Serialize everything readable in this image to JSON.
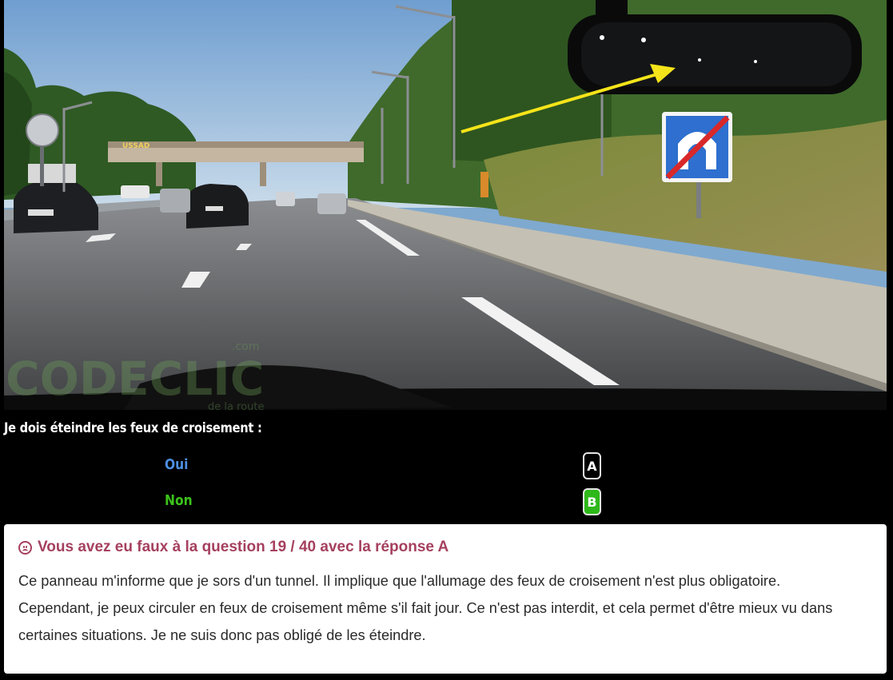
{
  "scene": {
    "description_icon": "road-photo",
    "watermark": "CODECLIC",
    "watermark_suffix": ".com",
    "watermark_tagline": "de la route",
    "bridge_sign": "USSAD"
  },
  "question": {
    "text": "Je dois éteindre les feux de croisement :"
  },
  "answers": [
    {
      "label": "Oui",
      "key": "A",
      "color": "#4d8fe0"
    },
    {
      "label": "Non",
      "key": "B",
      "color": "#3cc21c"
    }
  ],
  "feedback": {
    "icon": "sad-face-icon",
    "title": "Vous avez eu faux à la question 19 / 40 avec la réponse A",
    "explanation": "Ce panneau m'informe que je sors d'un tunnel. Il implique que l'allumage des feux de croisement n'est plus obligatoire. Cependant, je peux circuler en feux de croisement même s'il fait jour. Ce n'est pas interdit, et cela permet d'être mieux vu dans certaines situations. Je ne suis donc pas obligé de les éteindre.",
    "title_color": "#a5405e"
  }
}
